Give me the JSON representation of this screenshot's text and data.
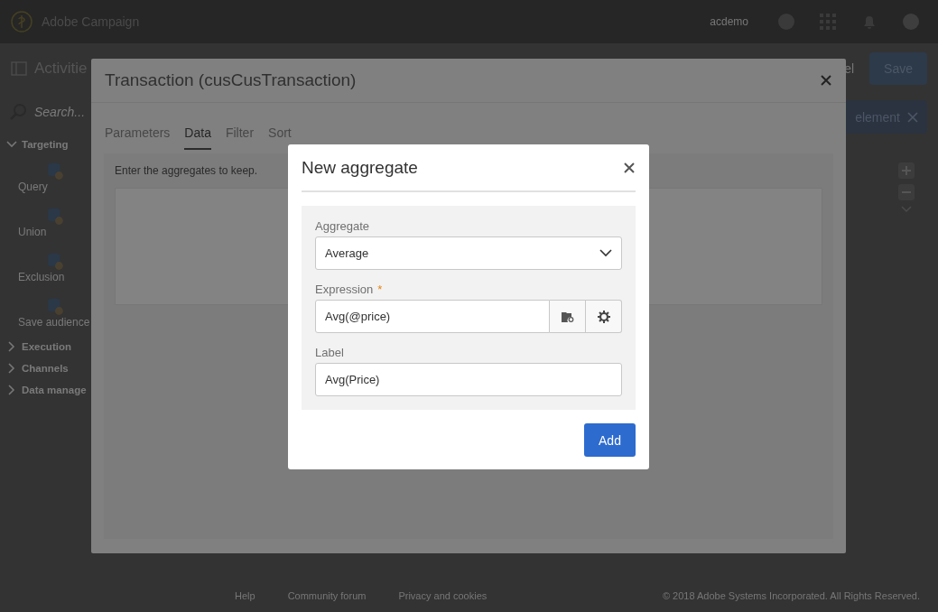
{
  "app_bar": {
    "product": "Adobe Campaign",
    "user": "acdemo"
  },
  "toolbar": {
    "title": "Activitie",
    "cancel": "el",
    "save": "Save",
    "element_chip": "element"
  },
  "sidebar": {
    "search_placeholder": "Search...",
    "sections": [
      {
        "label": "Targeting",
        "expanded": true,
        "items": [
          "Query",
          "Union",
          "Exclusion",
          "Save audience"
        ]
      },
      {
        "label": "Execution",
        "expanded": false
      },
      {
        "label": "Channels",
        "expanded": false
      },
      {
        "label": "Data manage",
        "expanded": false
      }
    ]
  },
  "footer": {
    "links": [
      "Help",
      "Community forum",
      "Privacy and cookies"
    ],
    "copyright": "© 2018 Adobe Systems Incorporated. All Rights Reserved."
  },
  "dialog": {
    "title": "Transaction (cusCusTransaction)",
    "tabs": [
      {
        "label": "Parameters",
        "selected": false
      },
      {
        "label": "Data",
        "selected": true
      },
      {
        "label": "Filter",
        "selected": false
      },
      {
        "label": "Sort",
        "selected": false
      }
    ],
    "hint": "Enter the aggregates to keep."
  },
  "modal": {
    "title": "New aggregate",
    "fields": [
      {
        "kind": "select",
        "label": "Aggregate",
        "value": "Average"
      },
      {
        "kind": "expression",
        "label": "Expression",
        "value": "Avg(@price)",
        "required_mark": "*"
      },
      {
        "kind": "text",
        "label": "Label",
        "value": "Avg(Price)"
      }
    ],
    "button": "Add"
  }
}
